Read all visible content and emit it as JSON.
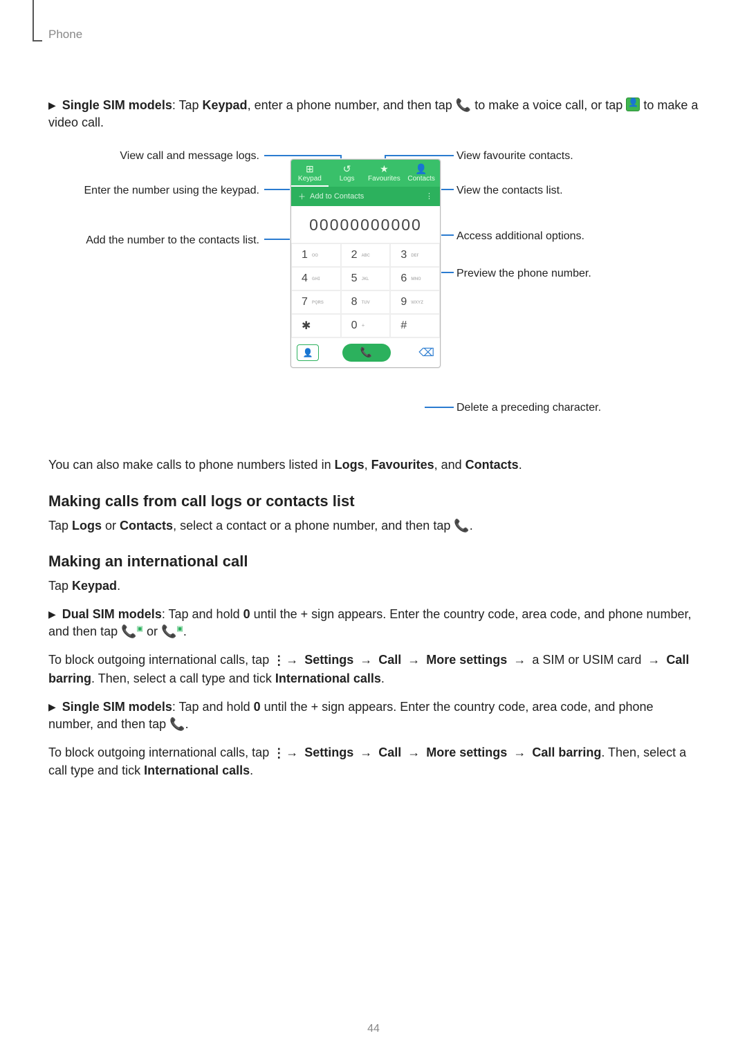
{
  "header": {
    "section": "Phone"
  },
  "intro": {
    "single_label": "Single SIM models",
    "single_text_a": ": Tap ",
    "keypad": "Keypad",
    "single_text_b": ", enter a phone number, and then tap ",
    "single_text_c": " to make a voice call, or tap ",
    "single_text_d": " to make a video call."
  },
  "callouts": {
    "logs": "View call and message logs.",
    "keypad": "Enter the number using the keypad.",
    "add": "Add the number to the contacts list.",
    "fav": "View favourite contacts.",
    "contacts": "View the contacts list.",
    "options": "Access additional options.",
    "preview": "Preview the phone number.",
    "delete": "Delete a preceding character."
  },
  "phone_mock": {
    "tabs": [
      "Keypad",
      "Logs",
      "Favourites",
      "Contacts"
    ],
    "add_to": "Add to Contacts",
    "number": "00000000000",
    "keys": [
      {
        "d": "1",
        "s": "ᴏᴏ"
      },
      {
        "d": "2",
        "s": "ᴀʙᴄ"
      },
      {
        "d": "3",
        "s": "ᴅᴇғ"
      },
      {
        "d": "4",
        "s": "ɢʜɪ"
      },
      {
        "d": "5",
        "s": "ᴊᴋʟ"
      },
      {
        "d": "6",
        "s": "ᴍɴᴏ"
      },
      {
        "d": "7",
        "s": "ᴘǫʀs"
      },
      {
        "d": "8",
        "s": "ᴛᴜᴠ"
      },
      {
        "d": "9",
        "s": "ᴡxʏᴢ"
      },
      {
        "d": "✱",
        "s": ""
      },
      {
        "d": "0",
        "s": "+"
      },
      {
        "d": "#",
        "s": ""
      }
    ]
  },
  "mid_line": {
    "a": "You can also make calls to phone numbers listed in ",
    "logs": "Logs",
    "b": ", ",
    "fav": "Favourites",
    "c": ", and ",
    "cont": "Contacts",
    "d": "."
  },
  "sect1": {
    "h": "Making calls from call logs or contacts list",
    "p_a": "Tap ",
    "logs": "Logs",
    "p_b": " or ",
    "cont": "Contacts",
    "p_c": ", select a contact or a phone number, and then tap ",
    "p_d": "."
  },
  "sect2": {
    "h": "Making an international call",
    "tap_keypad_a": "Tap ",
    "tap_keypad_b": "Keypad",
    "tap_keypad_c": ".",
    "dual_label": "Dual SIM models",
    "dual_a": ": Tap and hold ",
    "zero": "0",
    "dual_b": " until the + sign appears. Enter the country code, area code, and phone number, and then tap ",
    "or": " or ",
    "dot": ".",
    "block_a": "To block outgoing international calls, tap ",
    "menu_arrow": " → ",
    "settings": "Settings",
    "call": "Call",
    "more": "More settings",
    "block_b": " a SIM or USIM card ",
    "cb": "Call barring",
    "block_c": ". Then, select a call type and tick ",
    "intl": "International calls",
    "block_d": ".",
    "single_label": "Single SIM models",
    "single_a": ": Tap and hold ",
    "single_b": " until the + sign appears. Enter the country code, area code, and phone number, and then tap ",
    "single_c": ".",
    "block2_a": "To block outgoing international calls, tap ",
    "block2_b": ". Then, select a call type and tick "
  },
  "page_number": "44"
}
